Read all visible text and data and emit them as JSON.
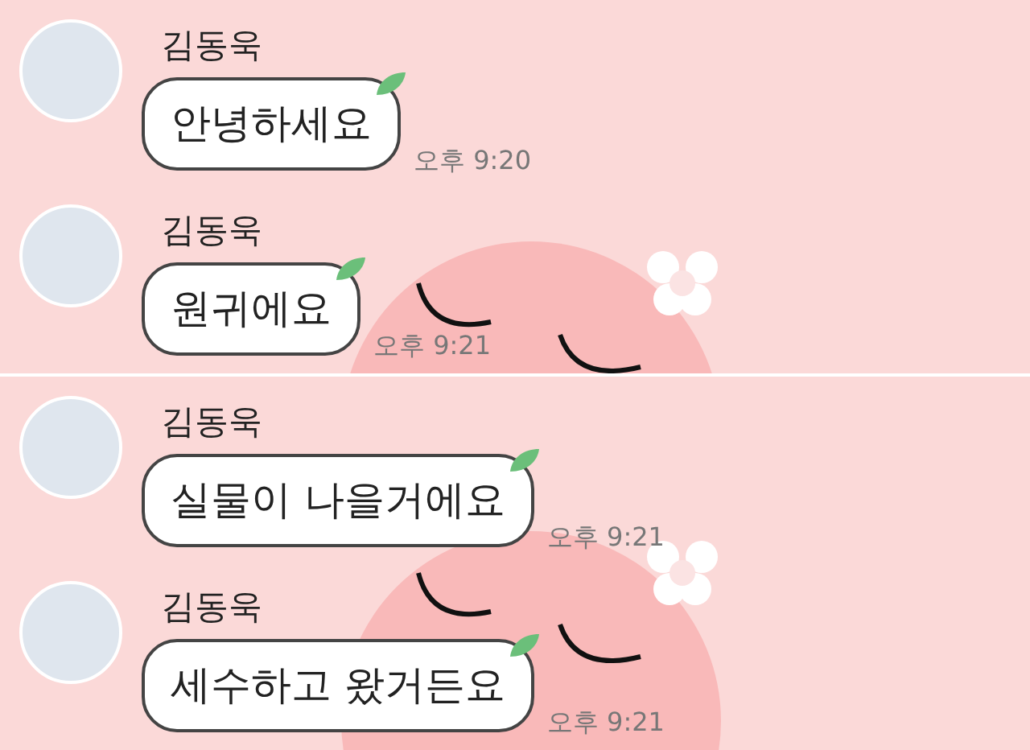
{
  "screens": [
    {
      "messages": [
        {
          "sender": "김동욱",
          "text": "안녕하세요",
          "time": "오후 9:20"
        },
        {
          "sender": "김동욱",
          "text": "원귀에요",
          "time": "오후 9:21"
        }
      ]
    },
    {
      "messages": [
        {
          "sender": "김동욱",
          "text": "실물이 나을거에요",
          "time": "오후 9:21"
        },
        {
          "sender": "김동욱",
          "text": "세수하고 왔거든요",
          "time": "오후 9:21"
        }
      ]
    }
  ]
}
